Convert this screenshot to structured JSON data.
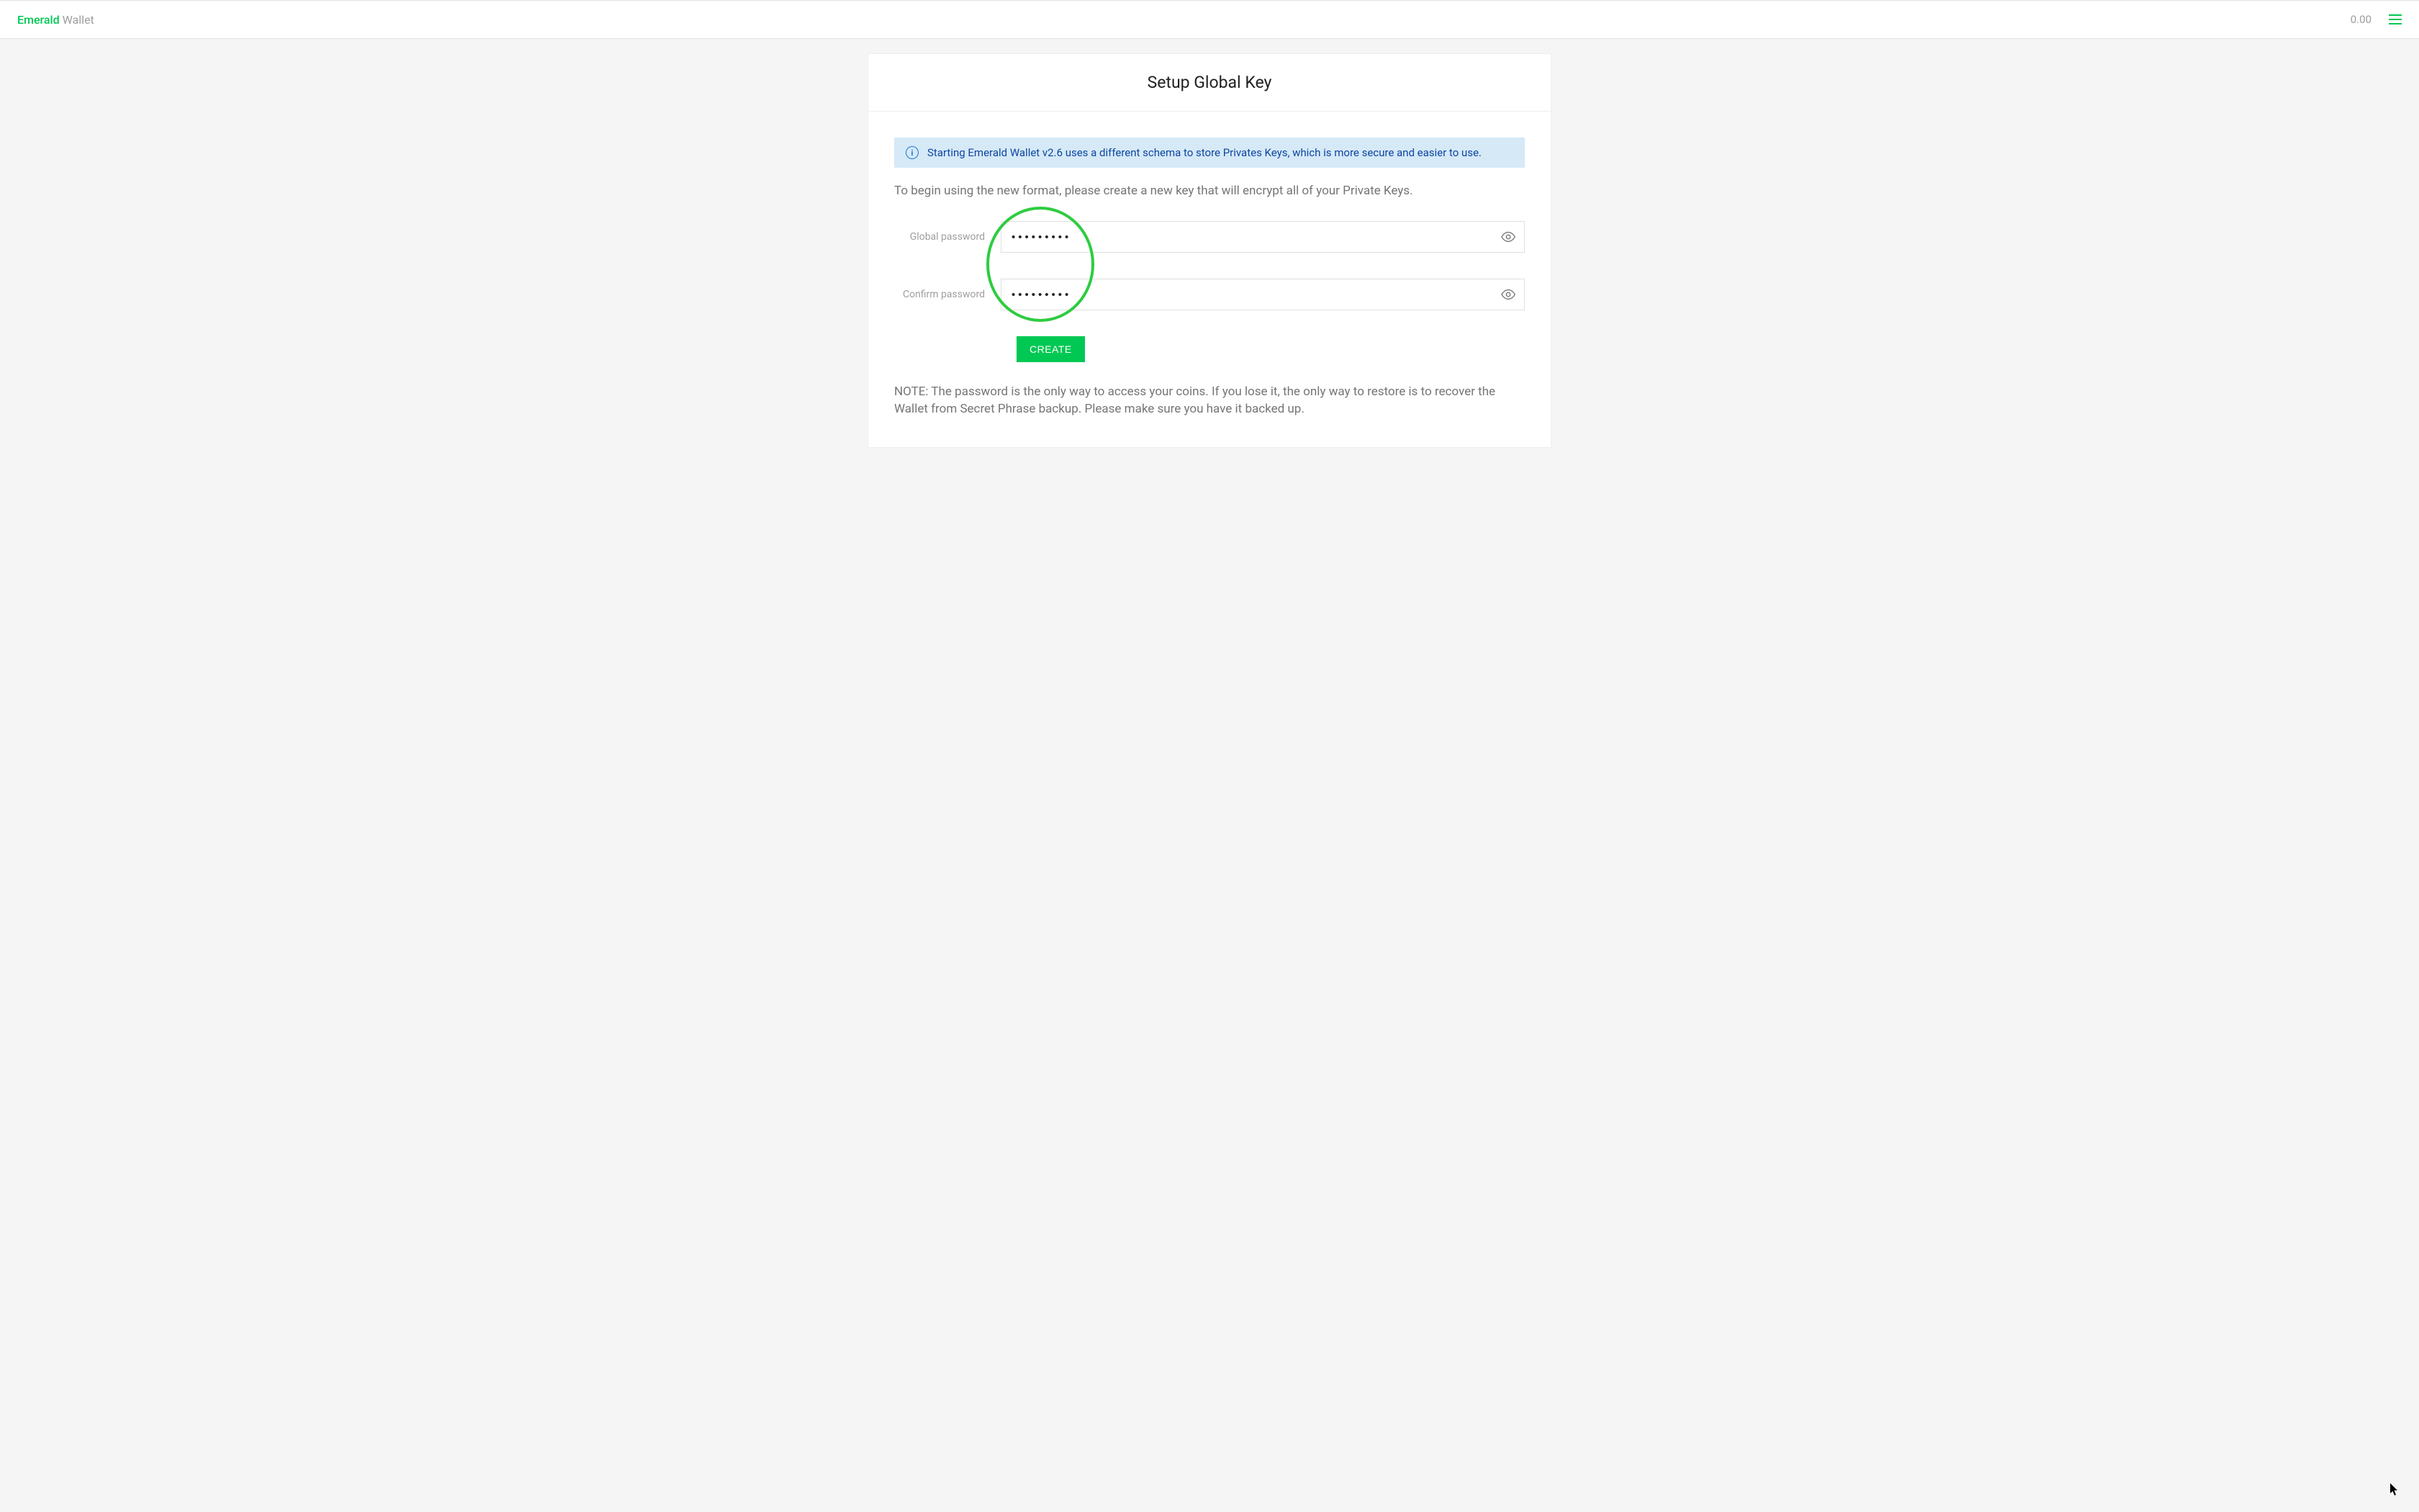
{
  "header": {
    "brand": "Emerald",
    "suffix": " Wallet",
    "balance": "0.00"
  },
  "page": {
    "title": "Setup Global Key",
    "infoBanner": "Starting Emerald Wallet v2.6 uses a different schema to store Privates Keys, which is more secure and easier to use.",
    "introText": "To begin using the new format, please create a new key that will encrypt all of your Private Keys.",
    "noteText": "NOTE: The password is the only way to access your coins. If you lose it, the only way to restore is to recover the Wallet from Secret Phrase backup. Please make sure you have it backed up."
  },
  "form": {
    "globalPassword": {
      "label": "Global password",
      "value": "•••••••••"
    },
    "confirmPassword": {
      "label": "Confirm password",
      "value": "•••••••••"
    },
    "createButton": "CREATE"
  }
}
